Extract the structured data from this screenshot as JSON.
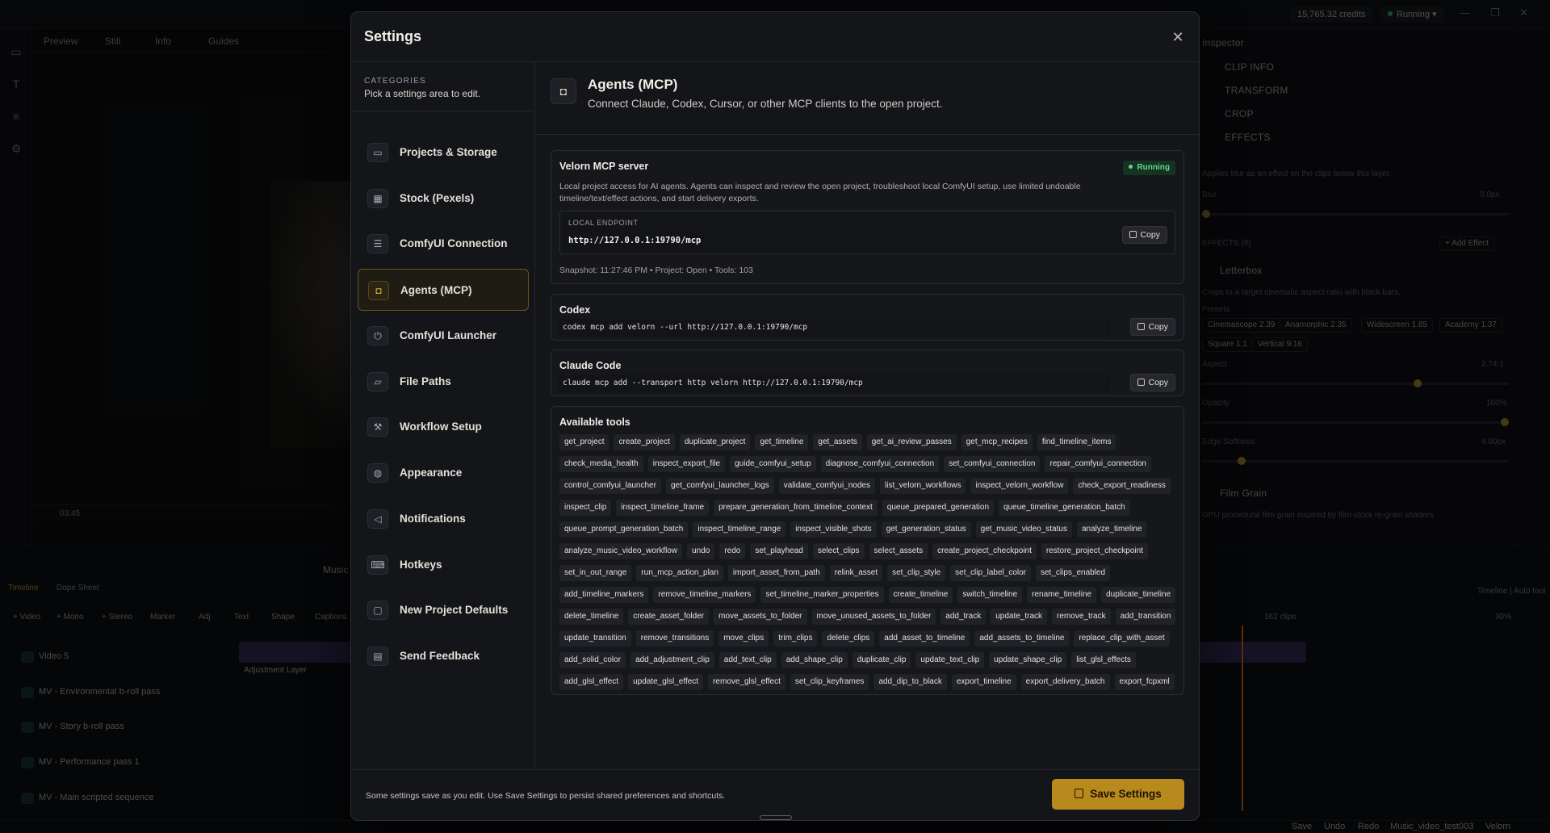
{
  "background": {
    "credits": "15,765.32 credits",
    "running": "Running",
    "preview_tabs": [
      "Preview",
      "Still",
      "Info",
      "Guides"
    ],
    "timecode": "03:45",
    "inspector": {
      "title": "Inspector",
      "sections": [
        "CLIP INFO",
        "TRANSFORM",
        "CROP",
        "EFFECTS"
      ],
      "blur_hint": "Applies blur as an effect on the clips below this layer.",
      "blur_label": "Blur",
      "blur_value": "0.0px",
      "effects_count": "EFFECTS (8)",
      "add_effect": "+ Add Effect",
      "letterbox": "Letterbox",
      "letterbox_desc": "Crops to a target cinematic aspect ratio with black bars.",
      "presets_label": "Presets",
      "presets": [
        "Cinemascope 2.39",
        "Anamorphic 2.35",
        "Widescreen 1.85",
        "Academy 1.37",
        "Square 1:1",
        "Vertical 9:16"
      ],
      "aspect_label": "Aspect",
      "aspect_value": "2.74:1",
      "opacity_label": "Opacity",
      "opacity_value": "100%",
      "edge_label": "Edge Softness",
      "edge_value": "4.00px",
      "film_grain": "Film Grain",
      "film_grain_desc": "GPU procedural film grain inspired by film-stock re-grain shaders."
    },
    "timeline": {
      "tabs": [
        "Timeline",
        "Dope Sheet"
      ],
      "toolbar": [
        "+ Video",
        "+ Mono",
        "+ Stereo",
        "Marker",
        "Adj",
        "Text",
        "Shape",
        "Captions"
      ],
      "tracks": [
        "Video 5",
        "MV - Environmental b-roll pass",
        "MV - Story b-roll pass",
        "MV - Performance pass 1",
        "MV - Main scripted sequence"
      ],
      "adjustment_label": "Adjustment Layer",
      "clips_count": "162 clips",
      "zoom": "30%",
      "mode": "Timeline | Auto tool",
      "music_tab": "Music"
    },
    "bottombar": [
      "Save",
      "Undo",
      "Redo",
      "Music_video_test003",
      "Velorn"
    ]
  },
  "modal": {
    "title": "Settings",
    "categories_label": "CATEGORIES",
    "categories_hint": "Pick a settings area to edit.",
    "nav": [
      {
        "label": "Projects & Storage",
        "icon": "drive-icon"
      },
      {
        "label": "Stock (Pexels)",
        "icon": "film-icon"
      },
      {
        "label": "ComfyUI Connection",
        "icon": "server-icon"
      },
      {
        "label": "Agents (MCP)",
        "icon": "bot-icon"
      },
      {
        "label": "ComfyUI Launcher",
        "icon": "power-icon"
      },
      {
        "label": "File Paths",
        "icon": "folder-icon"
      },
      {
        "label": "Workflow Setup",
        "icon": "wrench-icon"
      },
      {
        "label": "Appearance",
        "icon": "palette-icon"
      },
      {
        "label": "Notifications",
        "icon": "speaker-icon"
      },
      {
        "label": "Hotkeys",
        "icon": "keyboard-icon"
      },
      {
        "label": "New Project Defaults",
        "icon": "monitor-icon"
      },
      {
        "label": "Send Feedback",
        "icon": "message-icon"
      }
    ],
    "active_nav": "Agents (MCP)",
    "section": {
      "title": "Agents (MCP)",
      "subtitle": "Connect Claude, Codex, Cursor, or other MCP clients to the open project."
    },
    "server": {
      "title": "Velorn MCP server",
      "status": "Running",
      "description": "Local project access for AI agents. Agents can inspect and review the open project, troubleshoot local ComfyUI setup, use limited undoable timeline/text/effect actions, and start delivery exports.",
      "endpoint_label": "LOCAL ENDPOINT",
      "endpoint": "http://127.0.0.1:19790/mcp",
      "copy": "Copy",
      "snapshot": "Snapshot: 11:27:46 PM • Project: Open • Tools: 103"
    },
    "codex": {
      "title": "Codex",
      "command": "codex mcp add velorn --url http://127.0.0.1:19790/mcp",
      "copy": "Copy"
    },
    "claude": {
      "title": "Claude Code",
      "command": "claude mcp add --transport http velorn http://127.0.0.1:19790/mcp",
      "copy": "Copy"
    },
    "tools_title": "Available tools",
    "tools": [
      "get_project",
      "create_project",
      "duplicate_project",
      "get_timeline",
      "get_assets",
      "get_ai_review_passes",
      "get_mcp_recipes",
      "find_timeline_items",
      "check_media_health",
      "inspect_export_file",
      "guide_comfyui_setup",
      "diagnose_comfyui_connection",
      "set_comfyui_connection",
      "repair_comfyui_connection",
      "control_comfyui_launcher",
      "get_comfyui_launcher_logs",
      "validate_comfyui_nodes",
      "list_velorn_workflows",
      "inspect_velorn_workflow",
      "check_export_readiness",
      "inspect_clip",
      "inspect_timeline_frame",
      "prepare_generation_from_timeline_context",
      "queue_prepared_generation",
      "queue_timeline_generation_batch",
      "queue_prompt_generation_batch",
      "inspect_timeline_range",
      "inspect_visible_shots",
      "get_generation_status",
      "get_music_video_status",
      "analyze_timeline",
      "analyze_music_video_workflow",
      "undo",
      "redo",
      "set_playhead",
      "select_clips",
      "select_assets",
      "create_project_checkpoint",
      "restore_project_checkpoint",
      "set_in_out_range",
      "run_mcp_action_plan",
      "import_asset_from_path",
      "relink_asset",
      "set_clip_style",
      "set_clip_label_color",
      "set_clips_enabled",
      "add_timeline_markers",
      "remove_timeline_markers",
      "set_timeline_marker_properties",
      "create_timeline",
      "switch_timeline",
      "rename_timeline",
      "duplicate_timeline",
      "delete_timeline",
      "create_asset_folder",
      "move_assets_to_folder",
      "move_unused_assets_to_folder",
      "add_track",
      "update_track",
      "remove_track",
      "add_transition",
      "update_transition",
      "remove_transitions",
      "move_clips",
      "trim_clips",
      "delete_clips",
      "add_asset_to_timeline",
      "add_assets_to_timeline",
      "replace_clip_with_asset",
      "add_solid_color",
      "add_adjustment_clip",
      "add_text_clip",
      "add_shape_clip",
      "duplicate_clip",
      "update_text_clip",
      "update_shape_clip",
      "list_glsl_effects",
      "add_glsl_effect",
      "update_glsl_effect",
      "remove_glsl_effect",
      "set_clip_keyframes",
      "add_dip_to_black",
      "export_timeline",
      "export_delivery_batch",
      "export_fcpxml"
    ],
    "footer_note": "Some settings save as you edit. Use Save Settings to persist shared preferences and shortcuts.",
    "save_label": "Save Settings"
  }
}
